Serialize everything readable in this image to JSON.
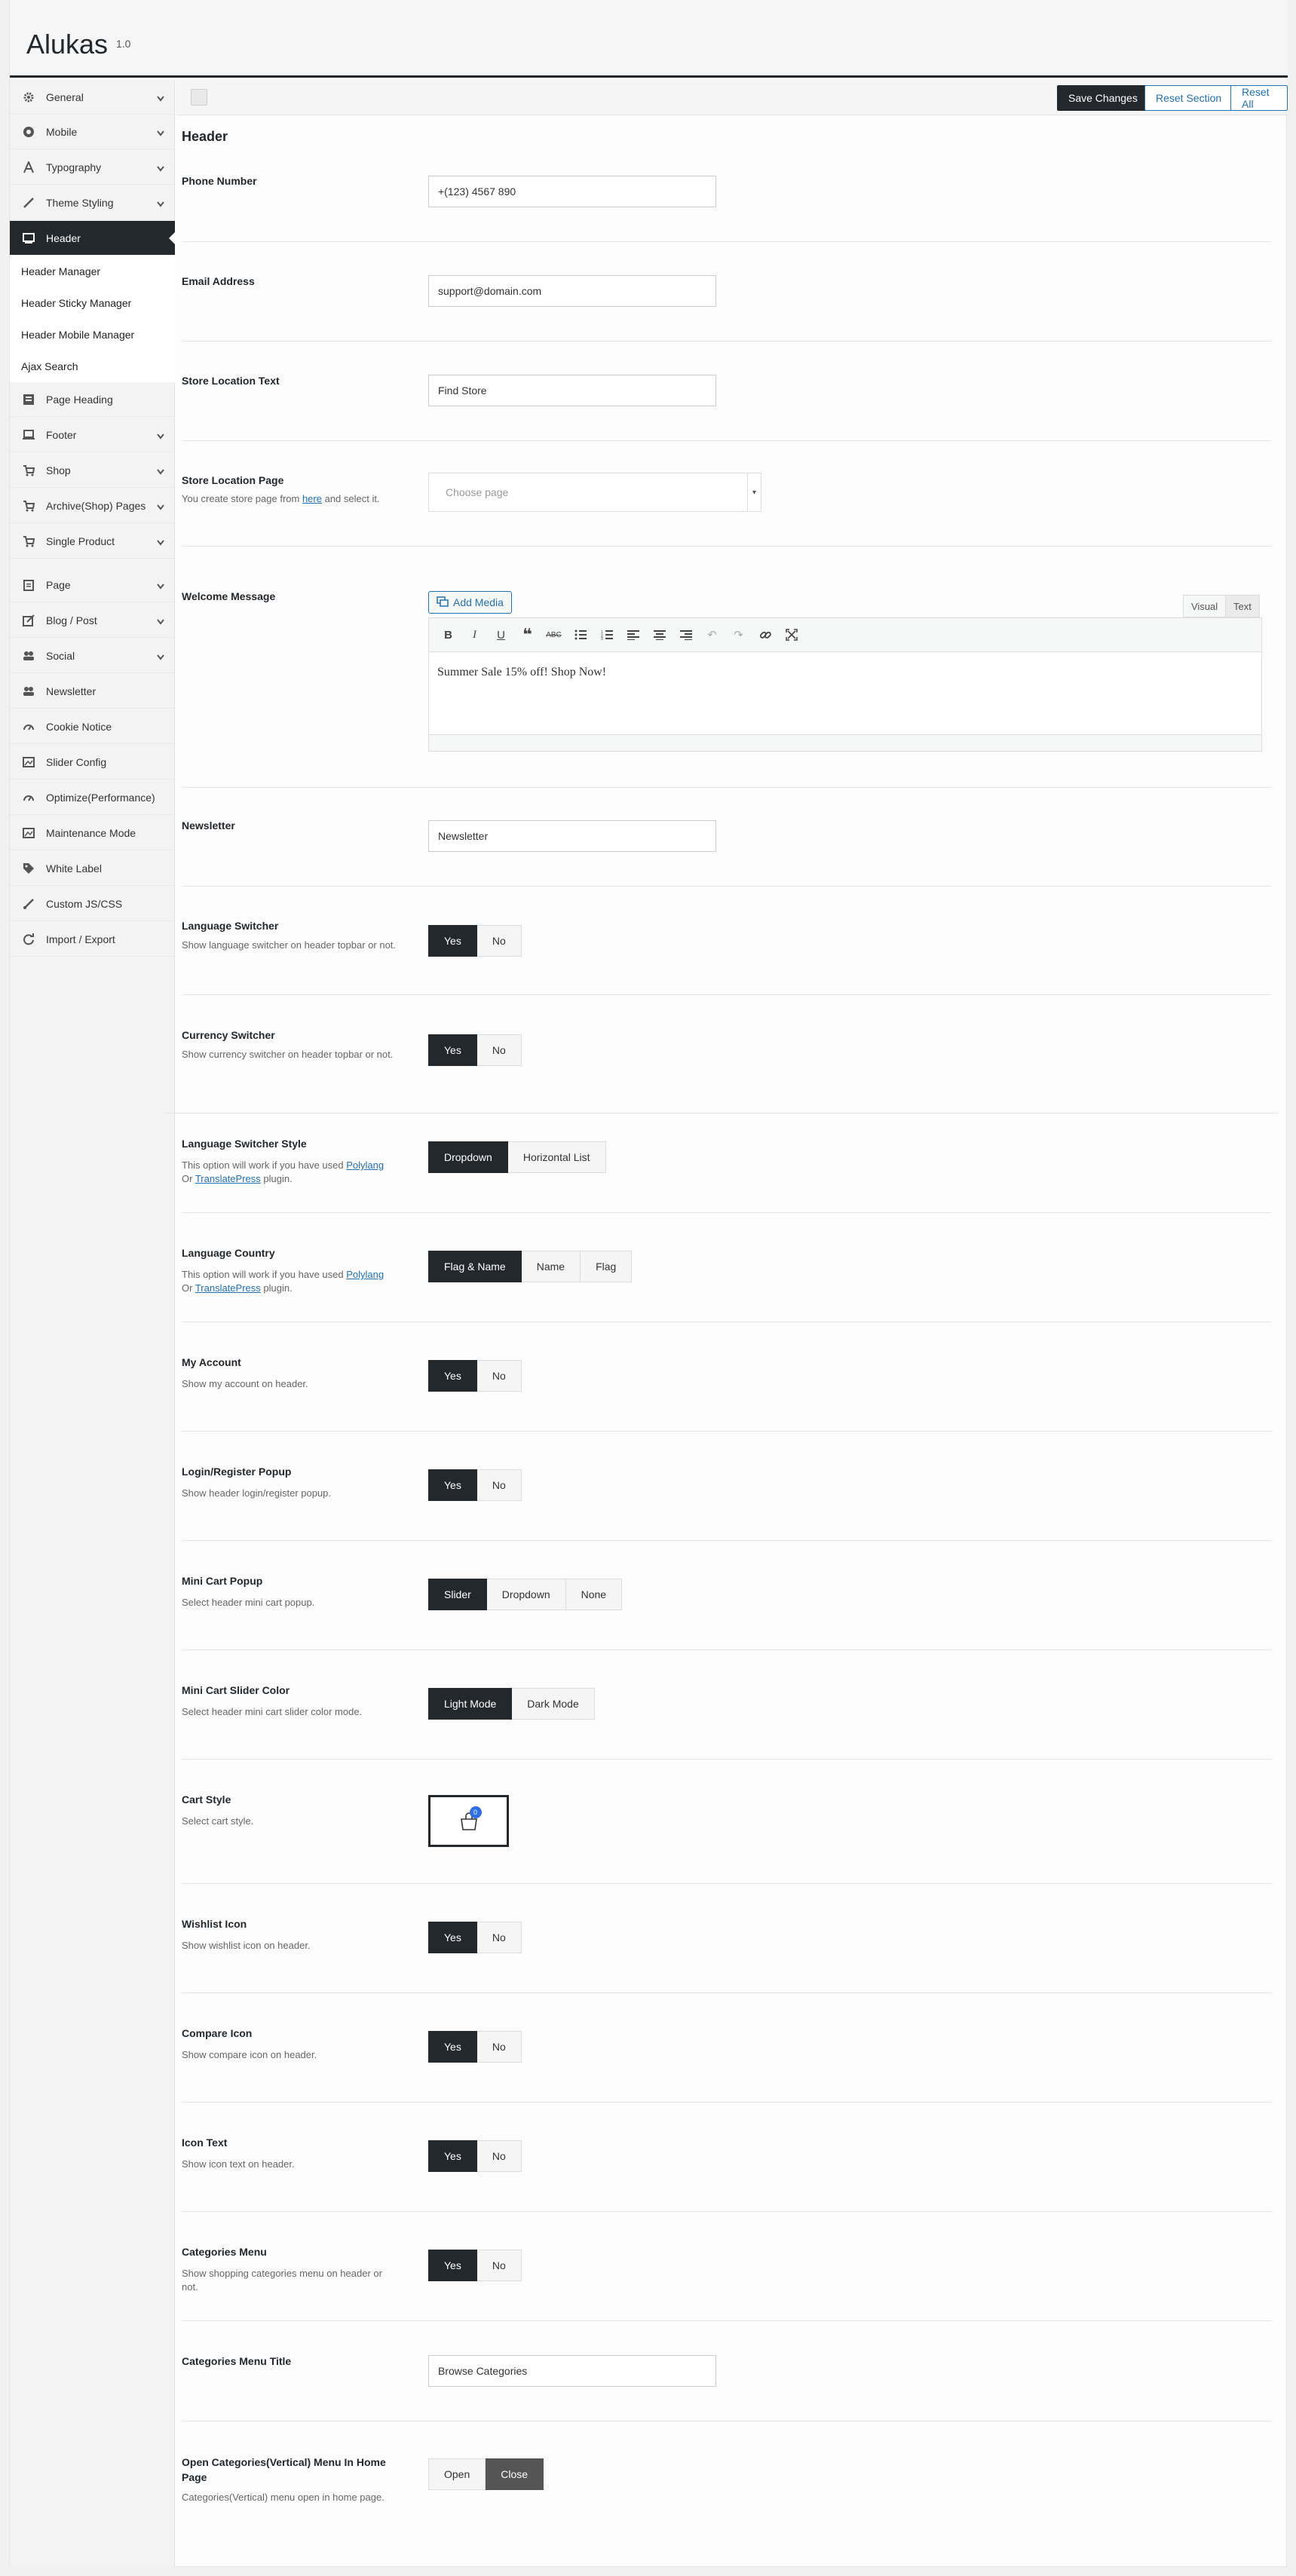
{
  "app": {
    "title": "Alukas",
    "version": "1.0"
  },
  "sidebar": {
    "items": [
      {
        "label": "General",
        "icon": "gear-icon",
        "chevron": true
      },
      {
        "label": "Mobile",
        "icon": "mobile-icon",
        "chevron": true
      },
      {
        "label": "Typography",
        "icon": "typography-icon",
        "chevron": true
      },
      {
        "label": "Theme Styling",
        "icon": "brush-icon",
        "chevron": true
      },
      {
        "label": "Header",
        "icon": "monitor-icon",
        "chevron": false,
        "active": true
      },
      {
        "label": "Page Heading",
        "icon": "heading-icon",
        "chevron": false
      },
      {
        "label": "Footer",
        "icon": "laptop-icon",
        "chevron": true
      },
      {
        "label": "Shop",
        "icon": "cart-icon",
        "chevron": true
      },
      {
        "label": "Archive(Shop) Pages",
        "icon": "cart-icon",
        "chevron": true
      },
      {
        "label": "Single Product",
        "icon": "cart-icon",
        "chevron": true
      },
      {
        "label": "Page",
        "icon": "clipboard-icon",
        "chevron": true
      },
      {
        "label": "Blog / Post",
        "icon": "edit-icon",
        "chevron": true
      },
      {
        "label": "Social",
        "icon": "users-icon",
        "chevron": true
      },
      {
        "label": "Newsletter",
        "icon": "users-icon",
        "chevron": false
      },
      {
        "label": "Cookie Notice",
        "icon": "gauge-icon",
        "chevron": false
      },
      {
        "label": "Slider Config",
        "icon": "image-icon",
        "chevron": false
      },
      {
        "label": "Optimize(Performance)",
        "icon": "gauge-icon",
        "chevron": false
      },
      {
        "label": "Maintenance Mode",
        "icon": "image-icon",
        "chevron": false
      },
      {
        "label": "White Label",
        "icon": "tag-icon",
        "chevron": false
      },
      {
        "label": "Custom JS/CSS",
        "icon": "brush-icon",
        "chevron": false
      },
      {
        "label": "Import / Export",
        "icon": "refresh-icon",
        "chevron": false
      }
    ],
    "subitems": [
      "Header Manager",
      "Header Sticky Manager",
      "Header Mobile Manager",
      "Ajax Search"
    ]
  },
  "toolbar": {
    "save": "Save Changes",
    "reset_section": "Reset Section",
    "reset_all": "Reset All"
  },
  "section": {
    "title": "Header"
  },
  "fields": {
    "phone": {
      "label": "Phone Number",
      "value": "+(123) 4567 890"
    },
    "email": {
      "label": "Email Address",
      "value": "support@domain.com"
    },
    "store_text": {
      "label": "Store Location Text",
      "value": "Find Store"
    },
    "store_page": {
      "label": "Store Location Page",
      "desc_before": "You create store page from ",
      "desc_link": "here",
      "desc_after": " and select it.",
      "placeholder": "Choose page"
    },
    "welcome": {
      "label": "Welcome Message",
      "add_media": "Add Media",
      "tab_visual": "Visual",
      "tab_text": "Text",
      "content": "Summer Sale 15% off! Shop Now!"
    },
    "newsletter": {
      "label": "Newsletter",
      "value": "Newsletter"
    },
    "lang_switcher": {
      "label": "Language Switcher",
      "desc": "Show language switcher on header topbar or not.",
      "yes": "Yes",
      "no": "No"
    },
    "currency_switcher": {
      "label": "Currency Switcher",
      "desc": "Show currency switcher on header topbar or not.",
      "yes": "Yes",
      "no": "No"
    },
    "lang_style": {
      "label": "Language Switcher Style",
      "desc_before": "This option will work if you have used ",
      "link1": "Polylang",
      "desc_mid": "Or ",
      "link2": "TranslatePress",
      "desc_after": " plugin.",
      "opt1": "Dropdown",
      "opt2": "Horizontal List"
    },
    "lang_country": {
      "label": "Language Country",
      "desc_before": "This option will work if you have used ",
      "link1": "Polylang",
      "desc_mid": "Or ",
      "link2": "TranslatePress",
      "desc_after": " plugin.",
      "opt1": "Flag & Name",
      "opt2": "Name",
      "opt3": "Flag"
    },
    "my_account": {
      "label": "My Account",
      "desc": "Show my account on header.",
      "yes": "Yes",
      "no": "No"
    },
    "login_popup": {
      "label": "Login/Register Popup",
      "desc": "Show header login/register popup.",
      "yes": "Yes",
      "no": "No"
    },
    "mini_cart": {
      "label": "Mini Cart Popup",
      "desc": "Select header mini cart popup.",
      "opt1": "Slider",
      "opt2": "Dropdown",
      "opt3": "None"
    },
    "mini_cart_color": {
      "label": "Mini Cart Slider Color",
      "desc": "Select header mini cart slider color mode.",
      "opt1": "Light Mode",
      "opt2": "Dark Mode"
    },
    "cart_style": {
      "label": "Cart Style",
      "desc": "Select cart style.",
      "badge": "0"
    },
    "wishlist": {
      "label": "Wishlist Icon",
      "desc": "Show wishlist icon on header.",
      "yes": "Yes",
      "no": "No"
    },
    "compare": {
      "label": "Compare Icon",
      "desc": "Show compare icon on header.",
      "yes": "Yes",
      "no": "No"
    },
    "icon_text": {
      "label": "Icon Text",
      "desc": "Show icon text on header.",
      "yes": "Yes",
      "no": "No"
    },
    "categories_menu": {
      "label": "Categories Menu",
      "desc": "Show shopping categories menu on header or not.",
      "yes": "Yes",
      "no": "No"
    },
    "categories_title": {
      "label": "Categories Menu Title",
      "value": "Browse Categories"
    },
    "open_categories": {
      "label": "Open Categories(Vertical) Menu In Home Page",
      "desc": "Categories(Vertical) menu open in home page.",
      "opt1": "Open",
      "opt2": "Close"
    }
  },
  "colors": {
    "dark": "#23282d",
    "link": "#2271b1",
    "badge": "#2f6fe0"
  }
}
